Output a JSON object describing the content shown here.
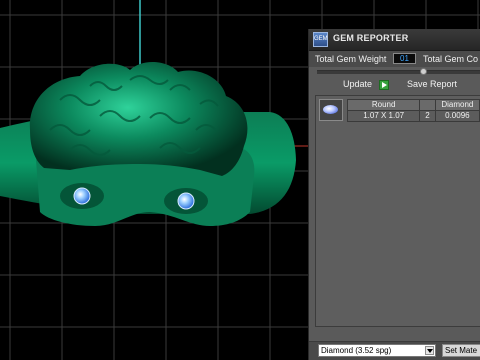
{
  "viewport": {
    "model_color": "#0b8a5e",
    "gem_color": "#4fa3ff",
    "grid_color": "#3a3a3a",
    "axis_color": "#3ec7c7"
  },
  "panel": {
    "title": "GEM REPORTER",
    "logo_text": "GEM",
    "total_gem_weight_label": "Total Gem Weight",
    "total_gem_weight_value": "01",
    "total_gem_count_label": "Total Gem Co",
    "update_label": "Update",
    "save_report_label": "Save Report",
    "table": {
      "headers": [
        "Round",
        "",
        "Diamond"
      ],
      "rows": [
        [
          "1.07 X 1.07",
          "2",
          "0.0096"
        ]
      ]
    },
    "material_select": "Diamond   (3.52 spg)",
    "set_material_label": "Set Mate"
  }
}
